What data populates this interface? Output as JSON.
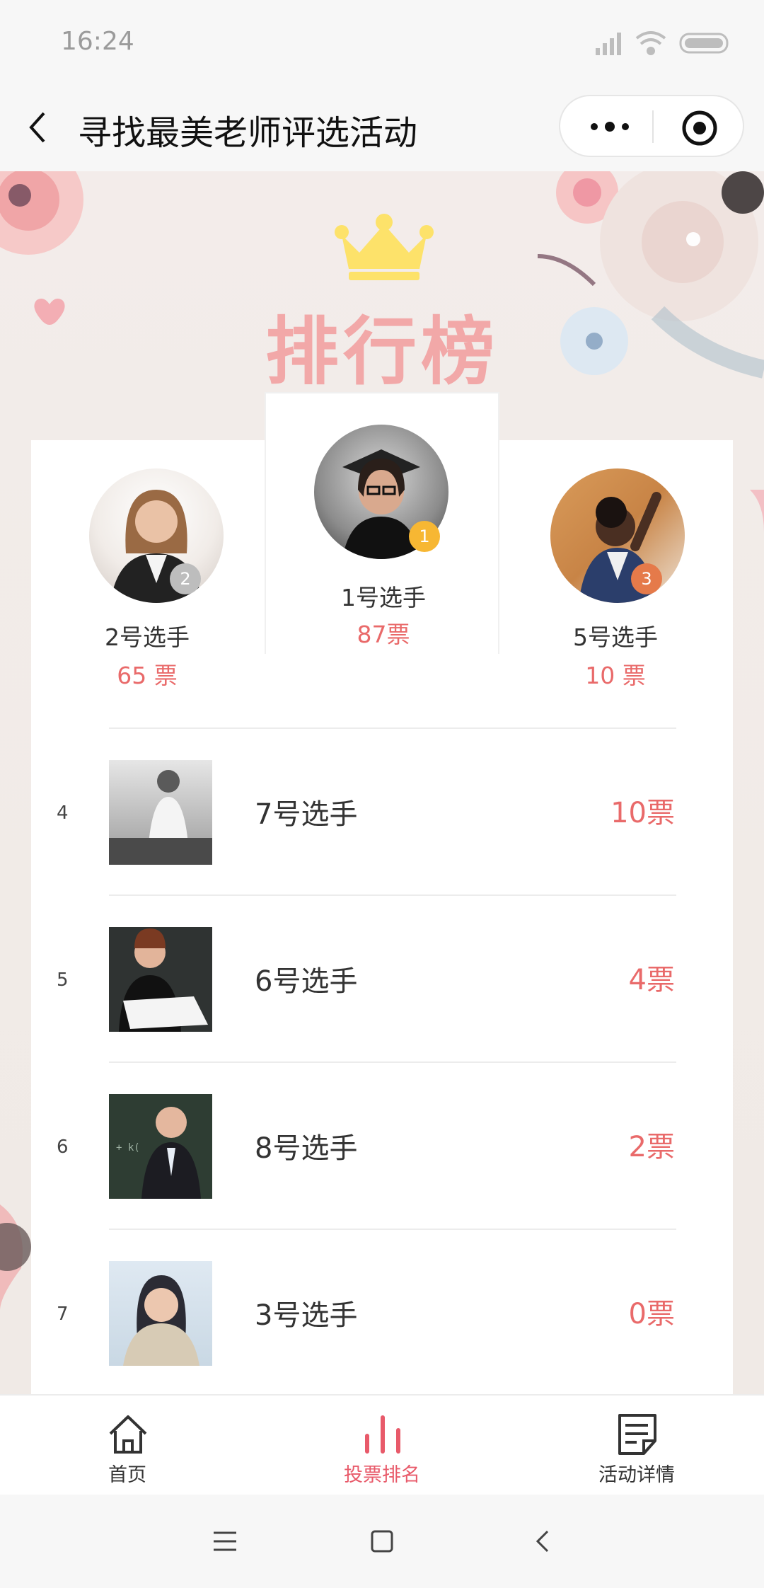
{
  "status": {
    "time": "16:24"
  },
  "navbar": {
    "title": "寻找最美老师评选活动"
  },
  "banner": {
    "title": "排行榜"
  },
  "podium": [
    {
      "place": "1",
      "name": "1号选手",
      "votes": "87票"
    },
    {
      "place": "2",
      "name": "2号选手",
      "votes": "65 票"
    },
    {
      "place": "3",
      "name": "5号选手",
      "votes": "10 票"
    }
  ],
  "ranking": [
    {
      "rank": "4",
      "name": "7号选手",
      "votes": "10票"
    },
    {
      "rank": "5",
      "name": "6号选手",
      "votes": "4票"
    },
    {
      "rank": "6",
      "name": "8号选手",
      "votes": "2票"
    },
    {
      "rank": "7",
      "name": "3号选手",
      "votes": "0票"
    }
  ],
  "tabbar": [
    {
      "label": "首页",
      "icon": "home-icon",
      "active": false
    },
    {
      "label": "投票排名",
      "icon": "bar-chart-icon",
      "active": true
    },
    {
      "label": "活动详情",
      "icon": "document-icon",
      "active": false
    }
  ],
  "colors": {
    "accent": "#e85a6a",
    "votes": "#e96a6a",
    "title": "#f2a8a8",
    "crown": "#fde26a"
  }
}
